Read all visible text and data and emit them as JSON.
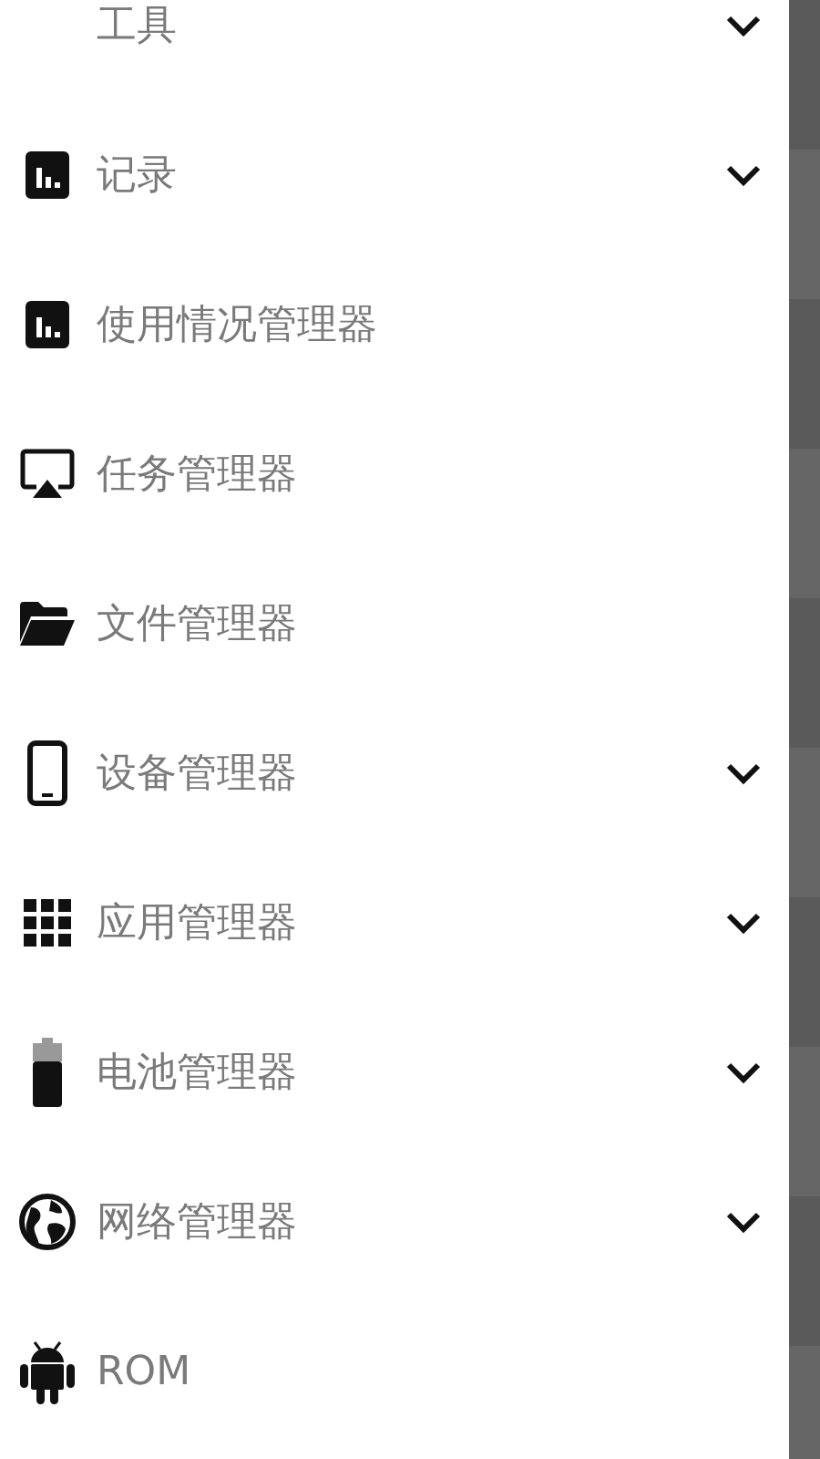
{
  "drawer": {
    "items": [
      {
        "label": "工具",
        "expanded": false
      },
      {
        "label": "记录",
        "expanded": false
      },
      {
        "label": "使用情况管理器"
      },
      {
        "label": "任务管理器"
      },
      {
        "label": "文件管理器"
      },
      {
        "label": "设备管理器",
        "expanded": false
      },
      {
        "label": "应用管理器",
        "expanded": false
      },
      {
        "label": "电池管理器",
        "expanded": false
      },
      {
        "label": "网络管理器",
        "expanded": false
      },
      {
        "label": "ROM"
      }
    ]
  }
}
